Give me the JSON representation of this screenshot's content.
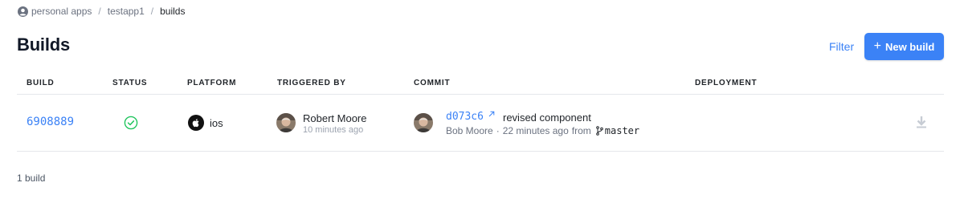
{
  "breadcrumb": {
    "items": [
      {
        "label": "personal apps"
      },
      {
        "label": "testapp1"
      },
      {
        "label": "builds"
      }
    ],
    "separator": "/",
    "icon": "account-circle-icon"
  },
  "page": {
    "title": "Builds"
  },
  "actions": {
    "filter_label": "Filter",
    "new_build_label": "New build",
    "new_build_icon": "+"
  },
  "table": {
    "columns": [
      "BUILD",
      "STATUS",
      "PLATFORM",
      "TRIGGERED BY",
      "COMMIT",
      "DEPLOYMENT"
    ],
    "rows": [
      {
        "build_id": "6908889",
        "status": "success",
        "status_icon": "check-circle-icon",
        "platform_icon": "apple-icon",
        "platform": "ios",
        "triggered_by": {
          "name": "Robert Moore",
          "time": "10 minutes ago"
        },
        "commit": {
          "hash": "d073c6",
          "message": "revised component",
          "author": "Bob Moore",
          "separator": "·",
          "time": "22 minutes ago",
          "from_label": "from",
          "branch_icon": "git-branch-icon",
          "branch": "master"
        },
        "deployment_action_icon": "download-icon"
      }
    ]
  },
  "footer": {
    "count_label": "1 build"
  },
  "colors": {
    "accent": "#3b82f6",
    "success": "#22c55e",
    "text": "#1f2328",
    "muted": "#6b7280",
    "border": "#e5e7eb"
  }
}
